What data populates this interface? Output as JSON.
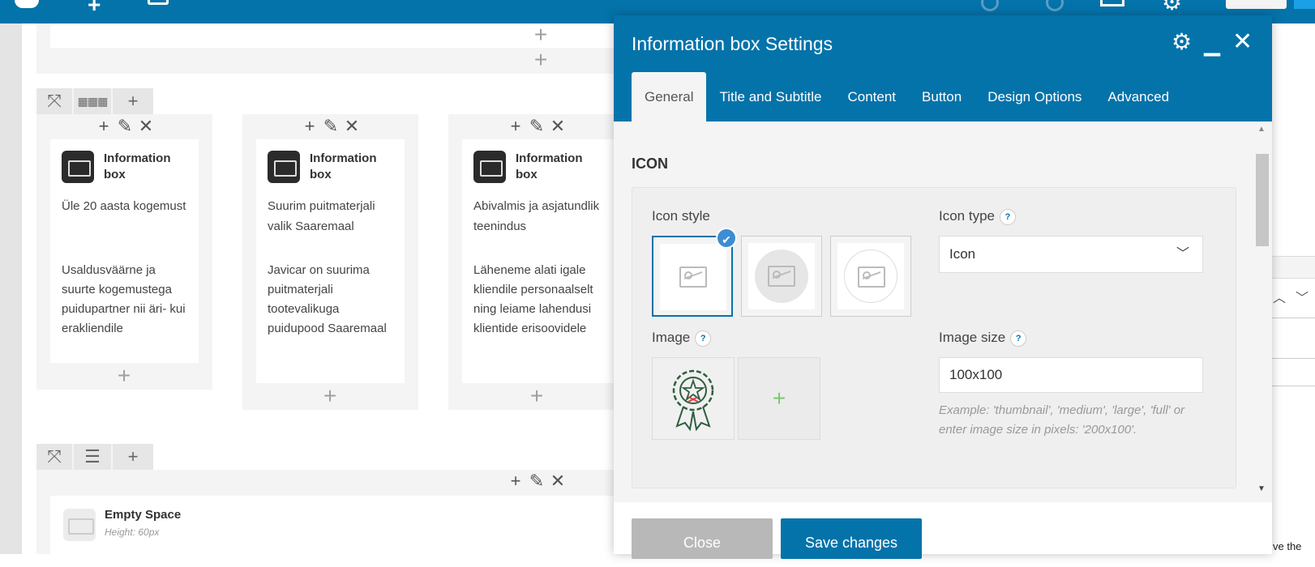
{
  "editor": {
    "columns": [
      {
        "title": "Information box",
        "lead": "Üle 20 aasta kogemust",
        "desc": "Usaldusväärne ja suurte kogemustega puidupartner nii äri- kui erakliendile"
      },
      {
        "title": "Information box",
        "lead": "Suurim puitmaterjali valik Saaremaal",
        "desc": "Javicar on suurima puitmaterjali tootevalikuga puidupood Saaremaal"
      },
      {
        "title": "Information box",
        "lead": "Abivalmis ja asjatundlik teenindus",
        "desc": "Läheneme alati igale kliendile personaalselt ning leiame lahendusi klientide erisoovidele"
      }
    ],
    "empty_space": {
      "title": "Empty Space",
      "subtitle": "Height: 60px"
    },
    "background_text": "ve the"
  },
  "panel": {
    "title": "Information box Settings",
    "tabs": [
      "General",
      "Title and Subtitle",
      "Content",
      "Button",
      "Design Options",
      "Advanced"
    ],
    "active_tab": "General",
    "section": "ICON",
    "icon_style_label": "Icon style",
    "icon_type_label": "Icon type",
    "icon_type_value": "Icon",
    "image_label": "Image",
    "image_size_label": "Image size",
    "image_size_value": "100x100",
    "image_size_note": "Example: 'thumbnail', 'medium', 'large', 'full' or enter image size in pixels: '200x100'.",
    "help_glyph": "?",
    "close_label": "Close",
    "save_label": "Save changes"
  },
  "colors": {
    "topbar": "#0473aa",
    "accent": "#0473aa",
    "add_plus": "#7bc86c"
  }
}
